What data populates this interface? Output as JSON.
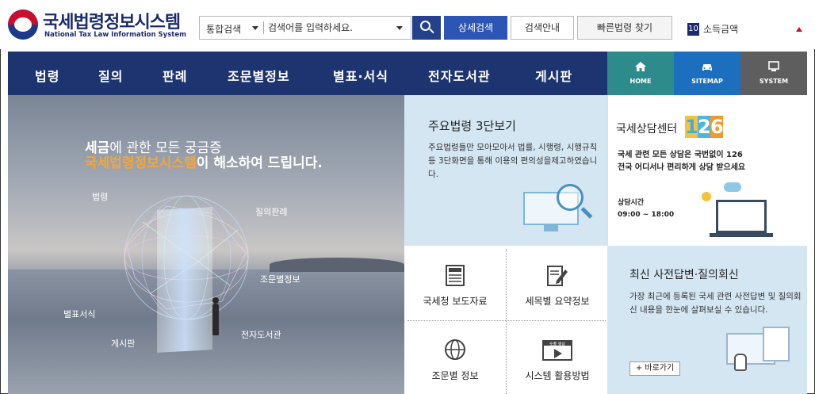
{
  "header": {
    "logo_title": "국세법령정보시스템",
    "logo_subtitle": "National Tax Law Information System",
    "search": {
      "type_selected": "통합검색",
      "placeholder": "검색어를 입력하세요."
    },
    "advanced_search_label": "상세검색",
    "search_guide_label": "검색안내",
    "quick_law_label": "빠른법령 찾기",
    "ranking": {
      "rank": "10",
      "text": "소득금액"
    }
  },
  "nav": {
    "items": [
      {
        "label": "법령"
      },
      {
        "label": "질의"
      },
      {
        "label": "판례"
      },
      {
        "label": "조문별정보"
      },
      {
        "label": "별표·서식"
      },
      {
        "label": "전자도서관"
      },
      {
        "label": "게시판"
      }
    ],
    "quick": [
      {
        "label": "HOME",
        "icon": "home-icon"
      },
      {
        "label": "SITEMAP",
        "icon": "car-icon"
      },
      {
        "label": "SYSTEM",
        "icon": "monitor-icon"
      }
    ]
  },
  "hero": {
    "line1_prefix": "세금",
    "line1_rest": "에 관한 모든 궁금증",
    "line2_highlight": "국세법령정보시스템",
    "line2_rest": "이 해소하여 드립니다.",
    "labels": {
      "law": "법령",
      "inquiry_case": "질의판례",
      "article_info": "조문별정보",
      "appendix_forms": "별표서식",
      "e_library": "전자도서관",
      "board": "게시판"
    }
  },
  "panels": {
    "major_laws": {
      "title": "주요법령 3단보기",
      "description": "주요법령들만 모아모아서 법률, 시행령, 시행규칙등 3단화면을 통해 이용의 편의성을제고하였습니다."
    },
    "counsel": {
      "title": "국세상담센터",
      "number_digits": [
        "1",
        "2",
        "6"
      ],
      "desc_line1": "국세 관련 모든 상담은 국번없이 126",
      "desc_line2": "전국 어디서나 편리하게 상담 받으세요",
      "hours_label": "상담시간",
      "hours": "09:00 ~ 18:00"
    },
    "tiles": [
      {
        "label": "국세청 보도자료",
        "icon": "newspaper-icon"
      },
      {
        "label": "세목별 요약정보",
        "icon": "document-edit-icon"
      },
      {
        "label": "조문별 정보",
        "icon": "globe-icon"
      },
      {
        "label": "시스템 활용방법",
        "icon": "video-icon"
      }
    ],
    "tile_video_badge": "숏폼 영상",
    "recent": {
      "title": "최신 사전답변·질의회신",
      "description": "가장 최근에 등록된 국세 관련 사전답변 및 질의회신 내용을 한눈에 살펴보실 수 있습니다.",
      "more_label": "+ 바로가기"
    }
  },
  "colors": {
    "nav_bg": "#1d3470",
    "home_bg": "#2d8c8b",
    "sitemap_bg": "#1c6fbf",
    "system_bg": "#5e5e5e",
    "accent_blue": "#2c55b5",
    "highlight_orange": "#f2a63c"
  }
}
